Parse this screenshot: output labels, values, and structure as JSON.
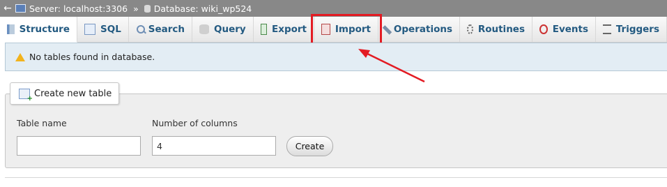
{
  "breadcrumb": {
    "back_glyph": "←",
    "server_label": "Server: localhost:3306",
    "separator": "»",
    "database_label": "Database: wiki_wp524"
  },
  "tabs": [
    {
      "label": "Structure",
      "icon": "structure-icon",
      "active": true
    },
    {
      "label": "SQL",
      "icon": "sql-icon"
    },
    {
      "label": "Search",
      "icon": "search-icon"
    },
    {
      "label": "Query",
      "icon": "query-icon"
    },
    {
      "label": "Export",
      "icon": "export-icon"
    },
    {
      "label": "Import",
      "icon": "import-icon",
      "highlighted": true
    },
    {
      "label": "Operations",
      "icon": "wrench-icon"
    },
    {
      "label": "Routines",
      "icon": "routines-icon"
    },
    {
      "label": "Events",
      "icon": "clock-icon"
    },
    {
      "label": "Triggers",
      "icon": "triggers-icon"
    }
  ],
  "notice": {
    "text": "No tables found in database.",
    "icon": "warning-icon"
  },
  "create_table": {
    "legend": "Create new table",
    "table_name_label": "Table name",
    "table_name_value": "",
    "columns_label": "Number of columns",
    "columns_value": "4",
    "create_button": "Create"
  },
  "colors": {
    "highlight": "#e31b23",
    "tab_text": "#235a81",
    "notice_bg": "#e3edf4"
  }
}
